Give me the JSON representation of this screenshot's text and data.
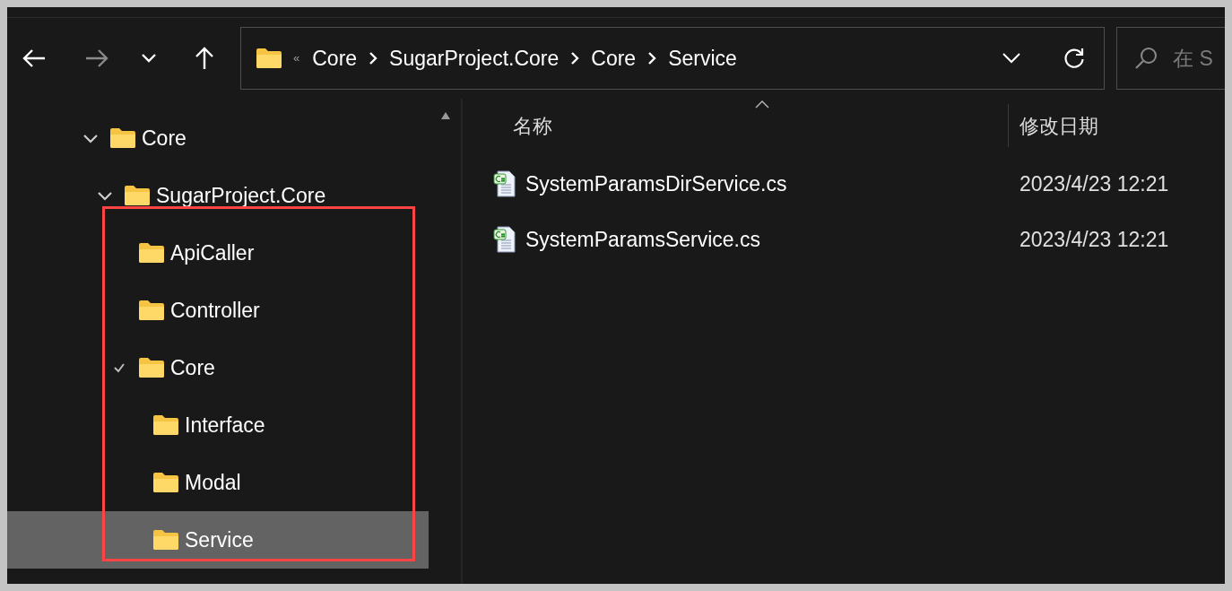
{
  "address_bar": {
    "overflow": "«",
    "breadcrumbs": [
      "Core",
      "SugarProject.Core",
      "Core",
      "Service"
    ]
  },
  "search": {
    "placeholder": "在 S"
  },
  "nav_tree": [
    {
      "label": "Core",
      "expanded": true,
      "selected": false,
      "children": [
        {
          "label": "SugarProject.Core",
          "expanded": true,
          "selected": false,
          "children": [
            {
              "label": "ApiCaller",
              "selected": false
            },
            {
              "label": "Controller",
              "selected": false
            },
            {
              "label": "Core",
              "expanded": true,
              "selected": false,
              "children": [
                {
                  "label": "Interface",
                  "selected": false
                },
                {
                  "label": "Modal",
                  "selected": false
                },
                {
                  "label": "Service",
                  "selected": true
                }
              ]
            }
          ]
        }
      ]
    }
  ],
  "file_list": {
    "columns": [
      "名称",
      "修改日期"
    ],
    "rows": [
      {
        "name": "SystemParamsDirService.cs",
        "modified": "2023/4/23 12:21"
      },
      {
        "name": "SystemParamsService.cs",
        "modified": "2023/4/23 12:21"
      }
    ]
  }
}
